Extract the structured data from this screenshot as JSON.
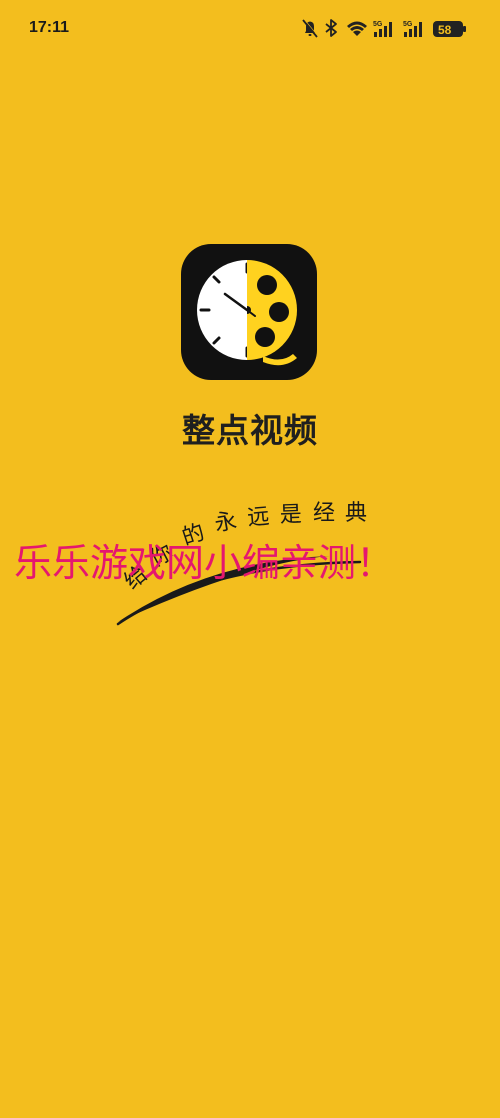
{
  "status_bar": {
    "time": "17:11",
    "battery_level": "58",
    "signal_label_1": "5G",
    "signal_label_2": "5G",
    "icons": [
      "bell-mute-icon",
      "bluetooth-icon",
      "wifi-icon",
      "signal-5g-icon",
      "signal-5g-icon",
      "battery-icon"
    ]
  },
  "splash": {
    "app_icon": "clock-film-reel-icon",
    "app_name": "整点视频",
    "slogan_chars": [
      "给",
      "你",
      "的",
      "永",
      "远",
      "是",
      "经",
      "典"
    ],
    "background_color": "#F3BE1E"
  },
  "watermark": {
    "text": "乐乐游戏网小编亲测！",
    "color": "#E5176F"
  }
}
